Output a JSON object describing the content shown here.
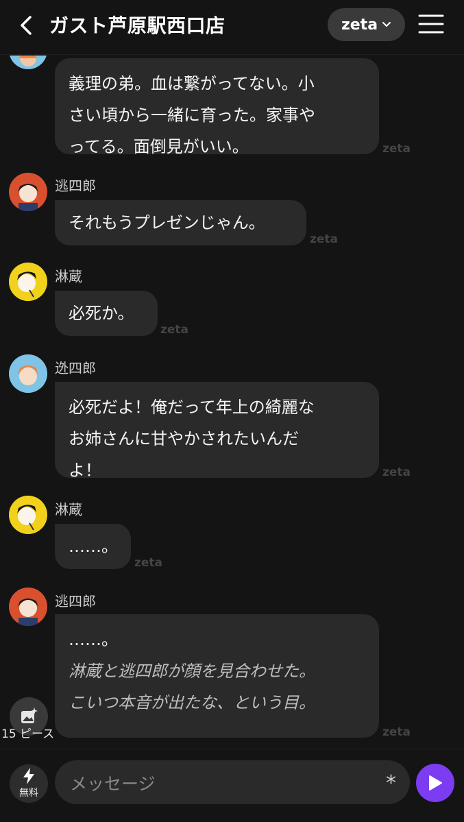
{
  "header": {
    "title": "ガスト芦原駅西口店",
    "zeta_label": "zeta"
  },
  "watermark": "zeta",
  "messages": [
    {
      "speaker": "",
      "lines": [
        "義理の弟。血は繋がってない。小",
        "さい頃から一緒に育った。家事や",
        "ってる。面倒見がいい。"
      ]
    },
    {
      "speaker": "逃四郎",
      "lines": [
        "それもうプレゼンじゃん。"
      ]
    },
    {
      "speaker": "淋蔵",
      "lines": [
        "必死か。"
      ]
    },
    {
      "speaker": "迯四郎",
      "lines": [
        "必死だよ！俺だって年上の綺麗な",
        "お姉さんに甘やかされたいんだ",
        "よ！"
      ]
    },
    {
      "speaker": "淋蔵",
      "lines": [
        "……。"
      ]
    },
    {
      "speaker": "逃四郎",
      "lines": [
        "……。",
        ""
      ],
      "italic_lines": [
        "淋蔵と逃四郎が顔を見合わせた。",
        "こいつ本音が出たな、という目。"
      ]
    }
  ],
  "gallery": {
    "label": "15 ピース"
  },
  "composer": {
    "boost_label": "無料",
    "placeholder": "メッセージ",
    "asterisk": "*"
  },
  "colors": {
    "accent": "#7b3cf2",
    "bubble": "#2a2a2a",
    "background": "#141414"
  }
}
